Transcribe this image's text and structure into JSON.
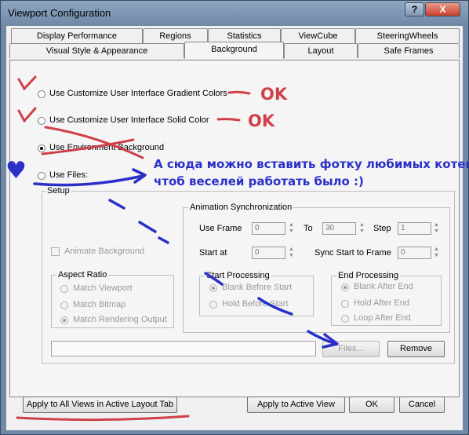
{
  "window": {
    "title": "Viewport Configuration",
    "help_label": "?",
    "close_label": "X"
  },
  "tabs": {
    "row1": [
      "Display Performance",
      "Regions",
      "Statistics",
      "ViewCube",
      "SteeringWheels"
    ],
    "row2": [
      "Visual Style & Appearance",
      "Background",
      "Layout",
      "Safe Frames"
    ],
    "active": "Background"
  },
  "background": {
    "options": [
      {
        "label": "Use Customize User Interface Gradient Colors",
        "selected": false
      },
      {
        "label": "Use Customize User Interface Solid Color",
        "selected": false
      },
      {
        "label": "Use Environment Background",
        "selected": true
      },
      {
        "label": "Use Files:",
        "selected": false
      }
    ]
  },
  "setup": {
    "title": "Setup",
    "animate_background": "Animate Background",
    "aspect_ratio": {
      "title": "Aspect Ratio",
      "options": [
        "Match Viewport",
        "Match Bitmap",
        "Match Rendering Output"
      ],
      "selected": 2
    },
    "animation_sync": {
      "title": "Animation Synchronization",
      "use_frame": "Use Frame",
      "use_frame_value": "0",
      "to": "To",
      "to_value": "30",
      "step": "Step",
      "step_value": "1",
      "start_at": "Start at",
      "start_at_value": "0",
      "sync_start": "Sync Start to Frame",
      "sync_start_value": "0"
    },
    "start_processing": {
      "title": "Start Processing",
      "options": [
        "Blank Before Start",
        "Hold Before Start"
      ],
      "selected": 0
    },
    "end_processing": {
      "title": "End Processing",
      "options": [
        "Blank After End",
        "Hold After End",
        "Loop After End"
      ],
      "selected": 0
    },
    "files_button": "Files...",
    "remove_button": "Remove"
  },
  "footer": {
    "apply_all": "Apply to All Views in Active Layout Tab",
    "apply_active": "Apply to Active View",
    "ok": "OK",
    "cancel": "Cancel"
  },
  "annotations": {
    "ok1": "OK",
    "ok2": "OK",
    "note_line1": "А сюда можно вставить фотку любимых котегов,",
    "note_line2": "чтоб веселей работать было :)",
    "heart": "♥",
    "red_color": "#d0404a",
    "blue_color": "#2a30c8"
  }
}
